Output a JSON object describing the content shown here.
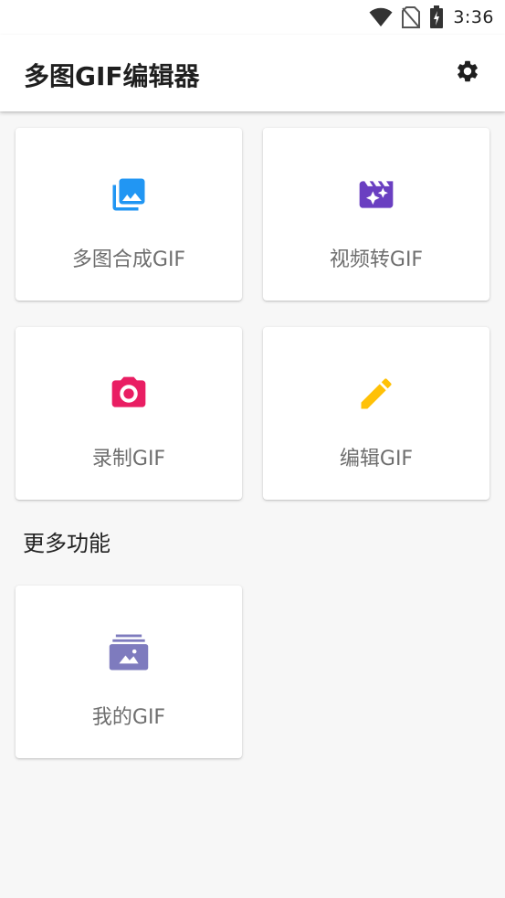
{
  "status_bar": {
    "time": "3:36",
    "icons": [
      "wifi-icon",
      "no-sim-icon",
      "battery-charging-icon"
    ]
  },
  "app_bar": {
    "title": "多图GIF编辑器",
    "settings_icon": "gear-icon"
  },
  "main_cards": [
    {
      "label": "多图合成GIF",
      "icon": "photo-library-icon",
      "color": "#2196f3"
    },
    {
      "label": "视频转GIF",
      "icon": "movie-filter-icon",
      "color": "#6a3fc1"
    },
    {
      "label": "录制GIF",
      "icon": "camera-icon",
      "color": "#e91e63"
    },
    {
      "label": "编辑GIF",
      "icon": "pencil-icon",
      "color": "#ffc107"
    }
  ],
  "more_section": {
    "title": "更多功能",
    "cards": [
      {
        "label": "我的GIF",
        "icon": "photo-album-icon",
        "color": "#7e7bbe"
      }
    ]
  }
}
